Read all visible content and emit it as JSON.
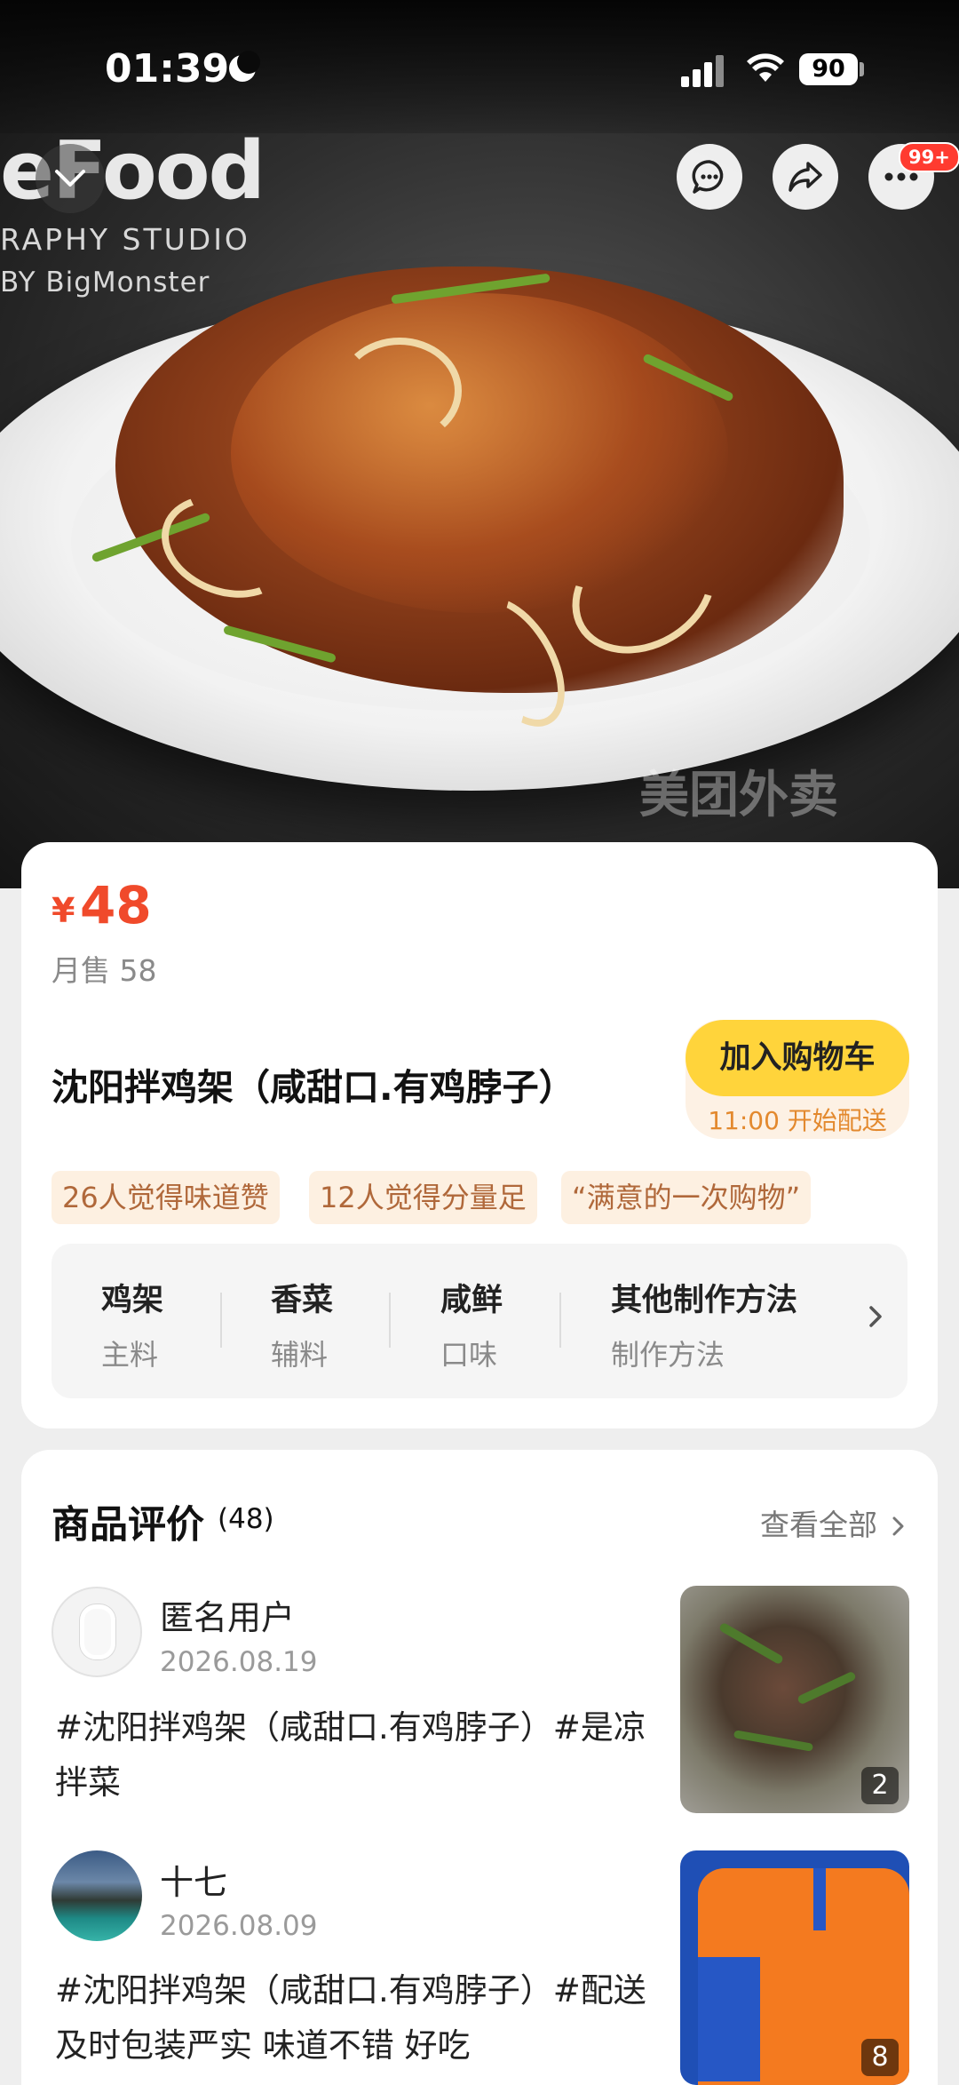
{
  "status_bar": {
    "time": "01:39",
    "battery": "90"
  },
  "hero": {
    "watermark_text": "eFood",
    "studio_line1": "RAPHY STUDIO",
    "studio_line2": "BY BigMonster",
    "platform_watermark": "美团外卖"
  },
  "top_actions": {
    "notification_badge": "99+"
  },
  "product": {
    "currency": "¥",
    "price": "48",
    "monthly_sales": "月售 58",
    "title": "沈阳拌鸡架（咸甜口.有鸡脖子）",
    "add_to_cart": "加入购物车",
    "delivery_note": "11:00 开始配送",
    "tags": [
      "26人觉得味道赞",
      "12人觉得分量足",
      "“满意的一次购物”"
    ],
    "attributes": [
      {
        "value": "鸡架",
        "label": "主料"
      },
      {
        "value": "香菜",
        "label": "辅料"
      },
      {
        "value": "咸鲜",
        "label": "口味"
      },
      {
        "value": "其他制作方法",
        "label": "制作方法"
      }
    ]
  },
  "reviews": {
    "title": "商品评价",
    "count": "(48)",
    "see_all": "查看全部",
    "items": [
      {
        "user": "匿名用户",
        "date": "2026.08.19",
        "text": "#沈阳拌鸡架（咸甜口.有鸡脖子）#是凉拌菜",
        "image_count": "2"
      },
      {
        "user": "十七",
        "date": "2026.08.09",
        "text": "#沈阳拌鸡架（咸甜口.有鸡脖子）#配送及时包装严实 味道不错 好吃",
        "image_count": "8"
      }
    ]
  },
  "colors": {
    "price_red": "#f04a2b",
    "cart_yellow": "#ffd43b",
    "tag_bg": "#fdf0e1",
    "tag_text": "#b0683a"
  }
}
